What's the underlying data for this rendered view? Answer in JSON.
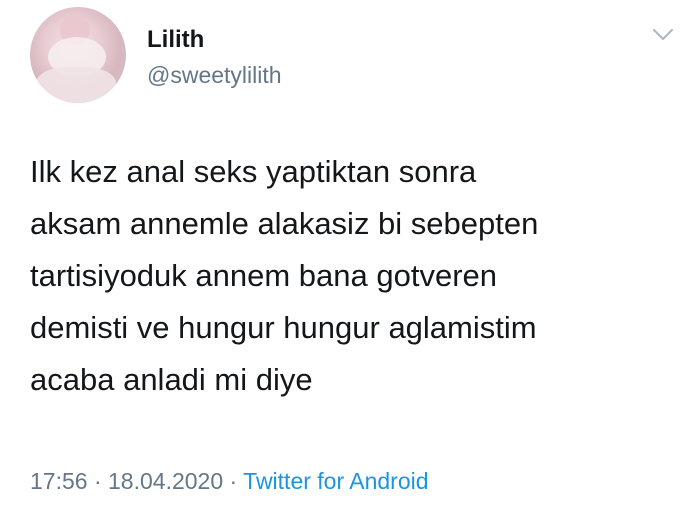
{
  "user": {
    "name": "Lilith",
    "handle": "@sweetylilith"
  },
  "tweet": {
    "lines": [
      "Ilk kez anal seks yaptiktan sonra",
      "aksam annemle alakasiz bi sebepten",
      "tartisiyoduk annem bana gotveren",
      "demisti ve hungur hungur aglamistim",
      "acaba anladi mi diye"
    ],
    "time": "17:56",
    "separator": " · ",
    "date": "18.04.2020",
    "source": "Twitter for Android"
  },
  "icons": {
    "menu": "chevron-down-icon"
  },
  "colors": {
    "text": "#14171a",
    "secondary": "#657786",
    "link": "#1b95e0"
  }
}
